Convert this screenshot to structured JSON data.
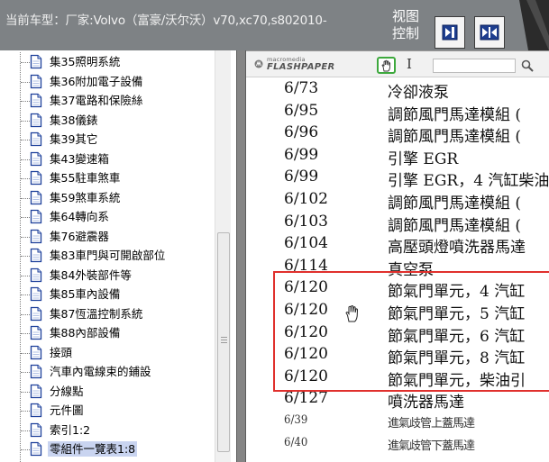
{
  "header": {
    "current_vehicle": "当前车型：厂家:Volvo（富豪/沃尔沃）v70,xc70,s802010-",
    "view_control": "视图\n控制"
  },
  "tree": {
    "items": [
      {
        "label": "集35照明系統"
      },
      {
        "label": "集36附加電子設備"
      },
      {
        "label": "集37電路和保險絲"
      },
      {
        "label": "集38儀錶"
      },
      {
        "label": "集39其它"
      },
      {
        "label": "集43變速箱"
      },
      {
        "label": "集55駐車煞車"
      },
      {
        "label": "集59煞車系統"
      },
      {
        "label": "集64轉向系"
      },
      {
        "label": "集76避震器"
      },
      {
        "label": "集83車門與可開啟部位"
      },
      {
        "label": "集84外裝部件等"
      },
      {
        "label": "集85車內設備"
      },
      {
        "label": "集87恆溫控制系統"
      },
      {
        "label": "集88內部設備"
      },
      {
        "label": "接頭"
      },
      {
        "label": "汽車內電線束的鋪設"
      },
      {
        "label": "分線點"
      },
      {
        "label": "元件圖"
      },
      {
        "label": "索引1:2"
      },
      {
        "label": "零組件一覽表1:8",
        "selected": true
      }
    ]
  },
  "viewer": {
    "brand_small": "macromedia",
    "brand_big": "FLASHPAPER",
    "ibeam_symbol": "I",
    "search_value": ""
  },
  "document": {
    "rows": [
      {
        "code": "6/73",
        "desc": "冷卻液泵"
      },
      {
        "code": "6/95",
        "desc": "調節風門馬達模組 ("
      },
      {
        "code": "6/96",
        "desc": "調節風門馬達模組 ("
      },
      {
        "code": "6/99",
        "desc": "引擎 EGR"
      },
      {
        "code": "6/99",
        "desc": "引擎 EGR，4 汽缸柴油"
      },
      {
        "code": "6/102",
        "desc": "調節風門馬達模組 ("
      },
      {
        "code": "6/103",
        "desc": "調節風門馬達模組 ("
      },
      {
        "code": "6/104",
        "desc": "高壓頭燈噴洗器馬達"
      },
      {
        "code": "6/114",
        "desc": "真空泵"
      },
      {
        "code": "6/120",
        "desc": "節氣門單元，4 汽缸"
      },
      {
        "code": "6/120",
        "desc": "節氣門單元，5 汽缸"
      },
      {
        "code": "6/120",
        "desc": "節氣門單元，6 汽缸"
      },
      {
        "code": "6/120",
        "desc": "節氣門單元，8 汽缸"
      },
      {
        "code": "6/120",
        "desc": "節氣門單元，柴油引"
      },
      {
        "code": "6/127",
        "desc": "噴洗器馬達"
      },
      {
        "code": "6/39",
        "desc": "進氣歧管上蓋馬達",
        "small": true
      },
      {
        "code": "6/40",
        "desc": "進氣歧管下蓋馬達",
        "small": true
      }
    ]
  },
  "colors": {
    "header_bg": "#7e8285",
    "highlight_border": "#e0302d",
    "selected_item_bg": "#c9d4f0",
    "hand_tool_border": "#3ea93e"
  }
}
